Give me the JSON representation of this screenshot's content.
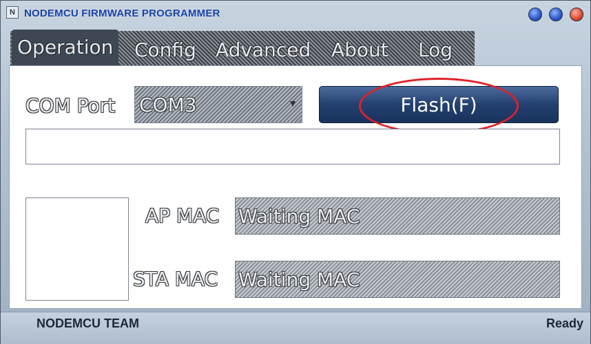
{
  "window": {
    "title": "NODEMCU FIRMWARE PROGRAMMER",
    "icon": "app-icon",
    "buttons": [
      "minimize-button",
      "maximize-button",
      "close-button"
    ]
  },
  "tabs": [
    {
      "label": "Operation",
      "active": true
    },
    {
      "label": "Config",
      "active": false
    },
    {
      "label": "Advanced",
      "active": false
    },
    {
      "label": "About",
      "active": false
    },
    {
      "label": "Log",
      "active": false
    }
  ],
  "operation": {
    "com_port_label": "COM Port",
    "com_port_value": "COM3",
    "flash_button_label": "Flash(F)",
    "ap_mac_label": "AP MAC",
    "ap_mac_value": "Waiting MAC",
    "sta_mac_label": "STA MAC",
    "sta_mac_value": "Waiting MAC",
    "progress_value": 0
  },
  "statusbar": {
    "left": "NODEMCU TEAM",
    "right": "Ready"
  },
  "colors": {
    "title_text": "#1740a8",
    "flash_button": "#23406f",
    "highlight": "#e0202a"
  }
}
